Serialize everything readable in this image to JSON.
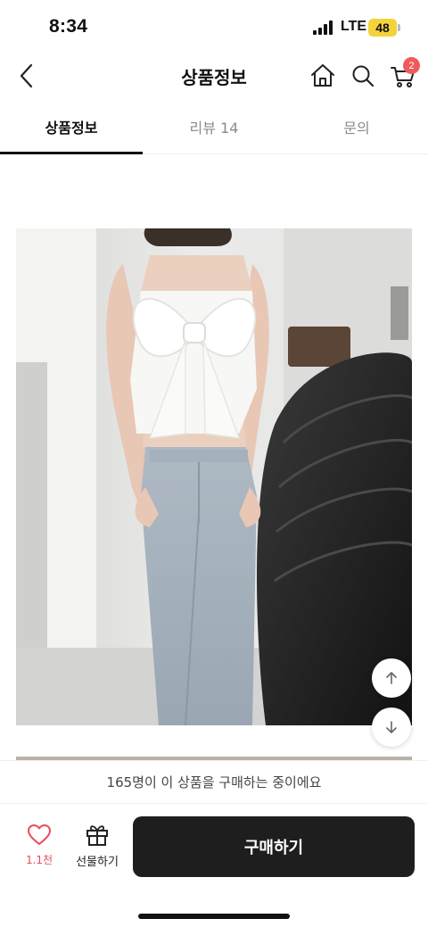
{
  "status_bar": {
    "time": "8:34",
    "network": "LTE",
    "battery": "48"
  },
  "header": {
    "title": "상품정보",
    "cart_count": "2"
  },
  "tabs": [
    {
      "label": "상품정보",
      "active": true
    },
    {
      "label": "리뷰 14",
      "active": false
    },
    {
      "label": "문의",
      "active": false
    }
  ],
  "notice": {
    "text": "165명이 이 상품을 구매하는 중이에요"
  },
  "bottom_bar": {
    "like_count": "1.1천",
    "gift_label": "선물하기",
    "buy_label": "구매하기"
  },
  "colors": {
    "accent_red": "#e84a5f",
    "badge_red": "#f05a5a",
    "buy_button": "#1e1e1e",
    "battery": "#f4d23c"
  }
}
